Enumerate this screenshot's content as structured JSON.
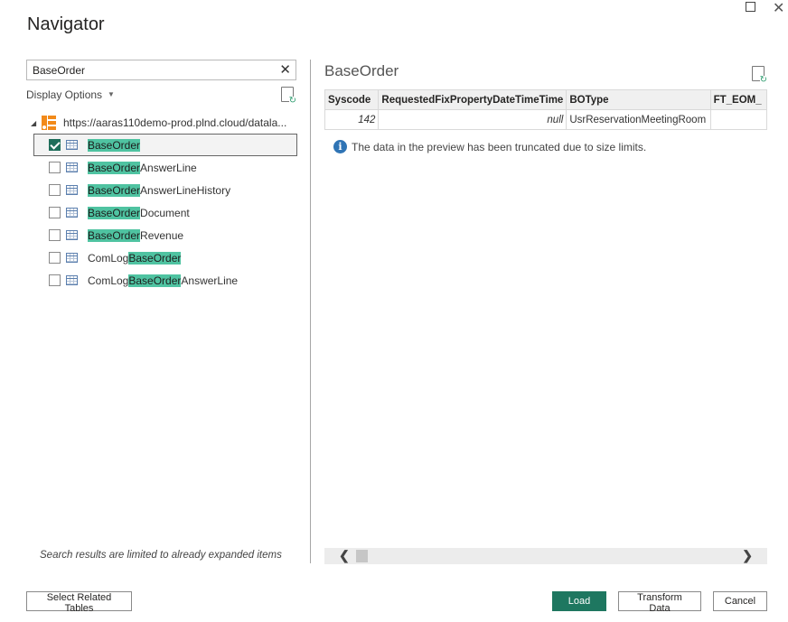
{
  "window": {
    "title": "Navigator",
    "maximize_icon": "maximize-icon",
    "close_icon": "close-icon",
    "close_glyph": "✕"
  },
  "left_pane": {
    "search": {
      "value": "BaseOrder",
      "placeholder": "",
      "clear_glyph": "✕"
    },
    "display_options_label": "Display Options",
    "display_options_caret": "▼",
    "refresh_icon": "refresh-file-icon",
    "tree": {
      "root": {
        "expander_glyph": "◢",
        "label": "https://aaras110demo-prod.plnd.cloud/datala...",
        "icon": "data-source-icon"
      },
      "items": [
        {
          "prefix": "",
          "match": "BaseOrder",
          "suffix": "",
          "checked": true,
          "selected": true
        },
        {
          "prefix": "",
          "match": "BaseOrder",
          "suffix": "AnswerLine",
          "checked": false,
          "selected": false
        },
        {
          "prefix": "",
          "match": "BaseOrder",
          "suffix": "AnswerLineHistory",
          "checked": false,
          "selected": false
        },
        {
          "prefix": "",
          "match": "BaseOrder",
          "suffix": "Document",
          "checked": false,
          "selected": false
        },
        {
          "prefix": "",
          "match": "BaseOrder",
          "suffix": "Revenue",
          "checked": false,
          "selected": false
        },
        {
          "prefix": "ComLog",
          "match": "BaseOrder",
          "suffix": "",
          "checked": false,
          "selected": false
        },
        {
          "prefix": "ComLog",
          "match": "BaseOrder",
          "suffix": "AnswerLine",
          "checked": false,
          "selected": false
        }
      ]
    },
    "search_note": "Search results are limited to already expanded items"
  },
  "preview": {
    "title": "BaseOrder",
    "columns": [
      "Syscode",
      "RequestedFixPropertyDateTimeTime",
      "BOType",
      "FT_EOM_"
    ],
    "rows": [
      [
        "142",
        "null",
        "UsrReservationMeetingRoom",
        ""
      ]
    ],
    "info_glyph": "i",
    "info_text": "The data in the preview has been truncated due to size limits.",
    "scroll_left_glyph": "❮",
    "scroll_right_glyph": "❯"
  },
  "footer": {
    "select_related_label": "Select Related Tables",
    "load_label": "Load",
    "transform_label": "Transform Data",
    "cancel_label": "Cancel"
  },
  "colors": {
    "accent": "#1e7760",
    "highlight": "#4fc3a1",
    "info": "#2f74b5",
    "source_icon": "#f28a1a"
  }
}
